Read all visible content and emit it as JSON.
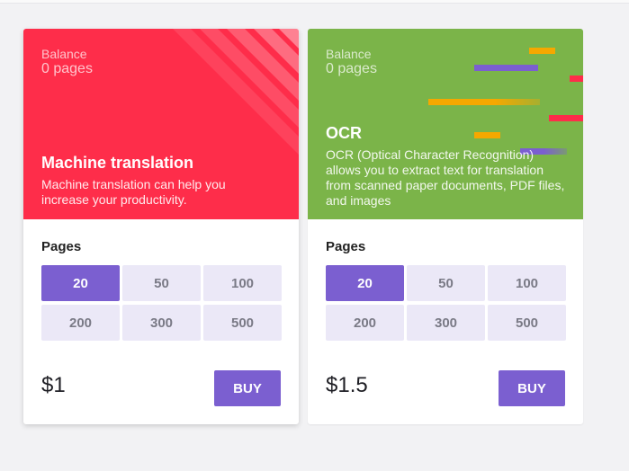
{
  "cards": [
    {
      "balance_label": "Balance",
      "balance_value": "0 pages",
      "title": "Machine translation",
      "description": "Machine translation can help you increase your productivity.",
      "hero_color": "#fe2d4a",
      "pages_label": "Pages",
      "options": [
        "20",
        "50",
        "100",
        "200",
        "300",
        "500"
      ],
      "selected_option": "20",
      "price": "$1",
      "buy_label": "BUY"
    },
    {
      "balance_label": "Balance",
      "balance_value": "0 pages",
      "title": "OCR",
      "description": "OCR (Optical Character Recognition) allows you to extract text for translation from scanned paper documents, PDF files, and images",
      "hero_color": "#7bb449",
      "pages_label": "Pages",
      "options": [
        "20",
        "50",
        "100",
        "200",
        "300",
        "500"
      ],
      "selected_option": "20",
      "price": "$1.5",
      "buy_label": "BUY"
    }
  ],
  "accent_color": "#7b5fd0"
}
